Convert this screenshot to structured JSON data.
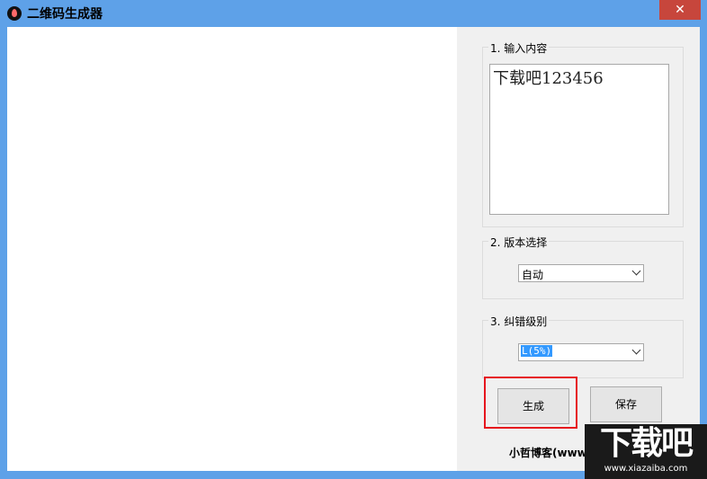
{
  "window": {
    "title": "二维码生成器",
    "close_label": "✕"
  },
  "groups": {
    "content": {
      "label": "1. 输入内容",
      "value": "下载吧123456"
    },
    "version": {
      "label": "2. 版本选择",
      "selected": "自动"
    },
    "ecc": {
      "label": "3. 纠错级别",
      "selected": "L(5%)"
    }
  },
  "buttons": {
    "generate": "生成",
    "save": "保存"
  },
  "footer": {
    "text": "小哲博客(www"
  },
  "watermark": {
    "main": "下载吧",
    "sub": "www.xiazaiba.com"
  },
  "colors": {
    "titlebar": "#5ea1e8",
    "close": "#c7463c",
    "highlight": "#e6161e",
    "selection": "#3399ff"
  },
  "icons": {
    "app": "app-drop-icon",
    "dropdown": "chevron-down-icon"
  }
}
